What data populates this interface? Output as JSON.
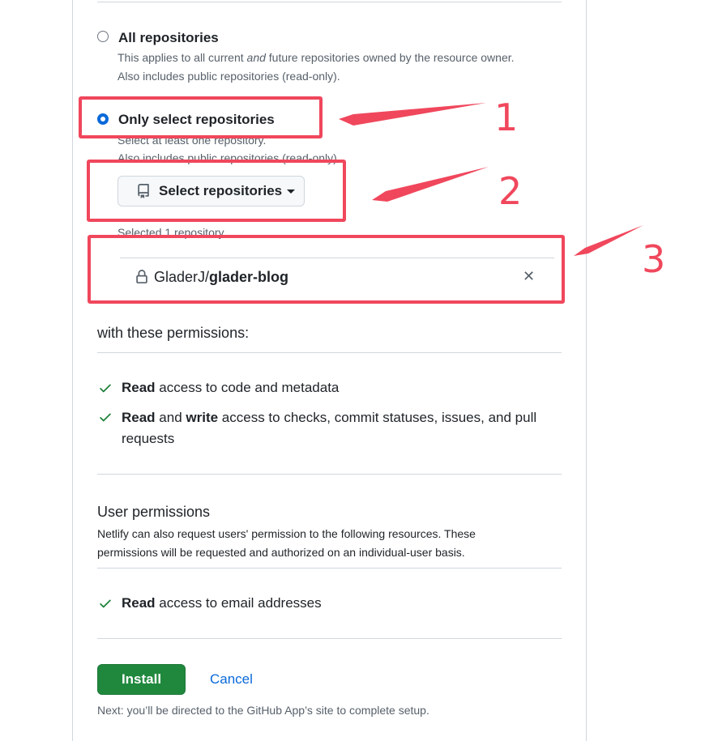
{
  "repository_access": {
    "all": {
      "label": "All repositories",
      "desc_before": "This applies to all current ",
      "desc_em": "and",
      "desc_after": " future repositories owned by the resource owner.",
      "desc_line2": "Also includes public repositories (read-only).",
      "selected": false
    },
    "select": {
      "label": "Only select repositories",
      "desc_line1": "Select at least one repository.",
      "desc_line2": "Also includes public repositories (read-only).",
      "selected": true
    },
    "select_button_label": "Select repositories",
    "selected_count_text": "Selected 1 repository.",
    "repo": {
      "owner": "GladerJ/",
      "name": "glader-blog"
    }
  },
  "permissions": {
    "heading": "with these permissions:",
    "items": [
      {
        "bold1": "Read",
        "text1": " access to code and metadata",
        "bold2": "",
        "text2": ""
      },
      {
        "bold1": "Read",
        "text1": " and ",
        "bold2": "write",
        "text2": " access to checks, commit statuses, issues, and pull requests"
      }
    ]
  },
  "user_permissions": {
    "heading": "User permissions",
    "desc": "Netlify can also request users' permission to the following resources. These permissions will be requested and authorized on an individual-user basis.",
    "items": [
      {
        "bold": "Read",
        "text": " access to email addresses"
      }
    ]
  },
  "actions": {
    "install_label": "Install",
    "cancel_label": "Cancel",
    "note": "Next: you’ll be directed to the GitHub App’s site to complete setup."
  },
  "annotations": {
    "labels": [
      "1",
      "2",
      "3"
    ],
    "color": "#f0475c"
  },
  "colors": {
    "accent_blue": "#0969da",
    "install_green": "#1f883d",
    "check_green": "#1a7f37"
  }
}
